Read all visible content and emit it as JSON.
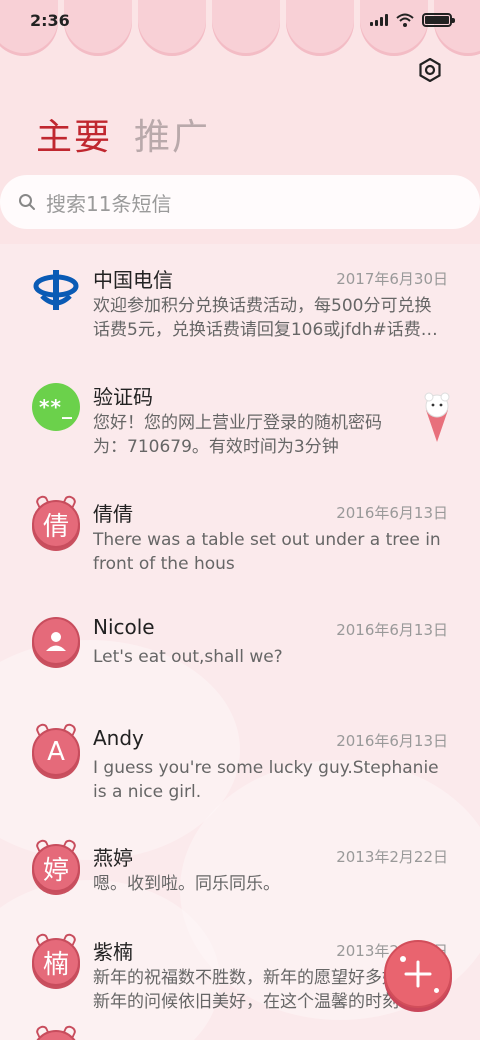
{
  "status": {
    "time": "2:36"
  },
  "tabs": {
    "primary": "主要",
    "promo": "推广"
  },
  "search": {
    "placeholder": "搜索11条短信"
  },
  "messages": [
    {
      "name": "中国电信",
      "date": "2017年6月30日",
      "preview": "欢迎参加积分兑换话费活动，每500分可兑换话费5元，兑换话费请回复106或jfdh#话费…",
      "avatar": "china-telecom-logo"
    },
    {
      "name": "验证码",
      "date": "",
      "preview": "您好！您的网上营业厅登录的随机密码为：710679。有效时间为3分钟",
      "avatar_text": "**_"
    },
    {
      "name": "倩倩",
      "date": "2016年6月13日",
      "preview": "There was a table set out under a tree in front of the hous",
      "avatar_text": "倩"
    },
    {
      "name": "Nicole",
      "date": "2016年6月13日",
      "preview": "Let's eat out,shall we?",
      "avatar": "person-icon"
    },
    {
      "name": "Andy",
      "date": "2016年6月13日",
      "preview": "I guess you're some lucky guy.Stephanie is a nice girl.",
      "avatar_text": "A"
    },
    {
      "name": "燕婷",
      "date": "2013年2月22日",
      "preview": "嗯。收到啦。同乐同乐。",
      "avatar_text": "婷"
    },
    {
      "name": "紫楠",
      "date": "2013年2月22日",
      "preview": "新年的祝福数不胜数，新年的愿望好多好多，新年的问候依旧美好，在这个温馨的时刻",
      "avatar_text": "楠"
    }
  ],
  "colors": {
    "accent": "#c0272f",
    "avatar_pink": "#e56a7a",
    "avatar_green": "#6bd14b",
    "fab": "#e9646f"
  }
}
